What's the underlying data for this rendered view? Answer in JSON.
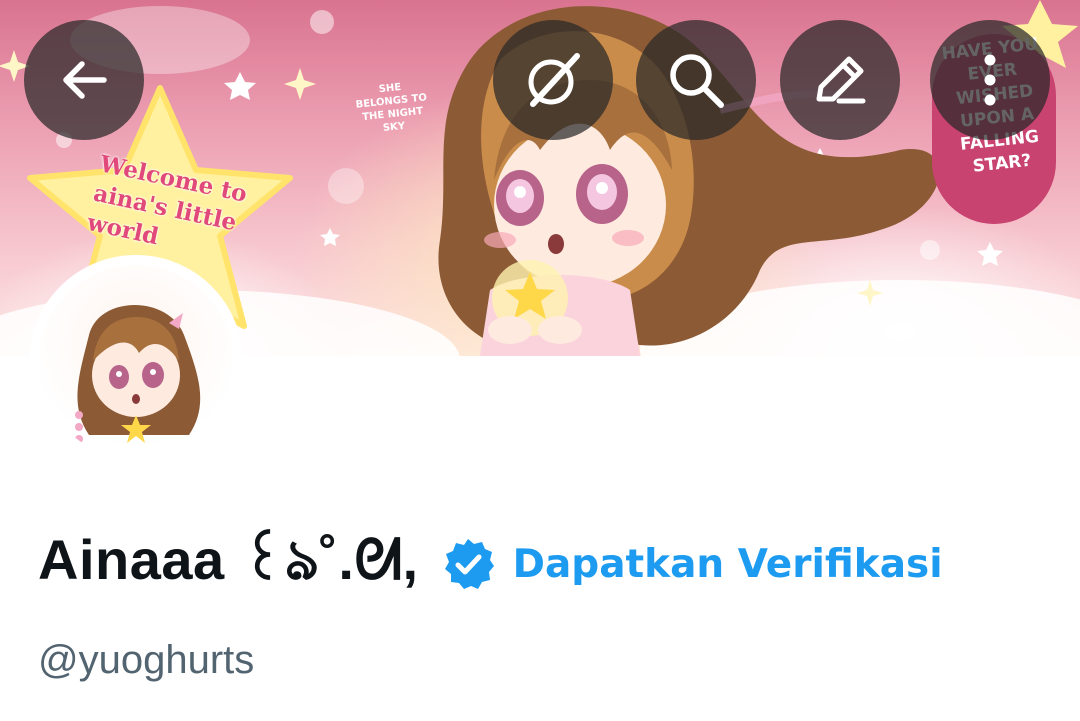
{
  "banner": {
    "welcome_text": "Welcome to aina's little world",
    "belongs_text": "SHE BELONGS TO THE NIGHT SKY",
    "bubble_text": "HAVE YOU EVER WISHED UPON A FALLING STAR?"
  },
  "header": {
    "back_icon": "arrow-left-icon",
    "grok_icon": "grok-slash-icon",
    "search_icon": "search-icon",
    "edit_icon": "pencil-icon",
    "more_icon": "more-vertical-icon"
  },
  "profile": {
    "display_name": "Ainaaa ꒰ঌ˚.ᘛ,",
    "verified_badge_icon": "verified-badge-icon",
    "verify_link": "Dapatkan Verifikasi",
    "handle": "@yuoghurts"
  },
  "colors": {
    "link_blue": "#1d9bf0",
    "text_primary": "#0f1419",
    "text_secondary": "#536471",
    "button_overlay": "rgba(40,40,40,0.72)"
  }
}
